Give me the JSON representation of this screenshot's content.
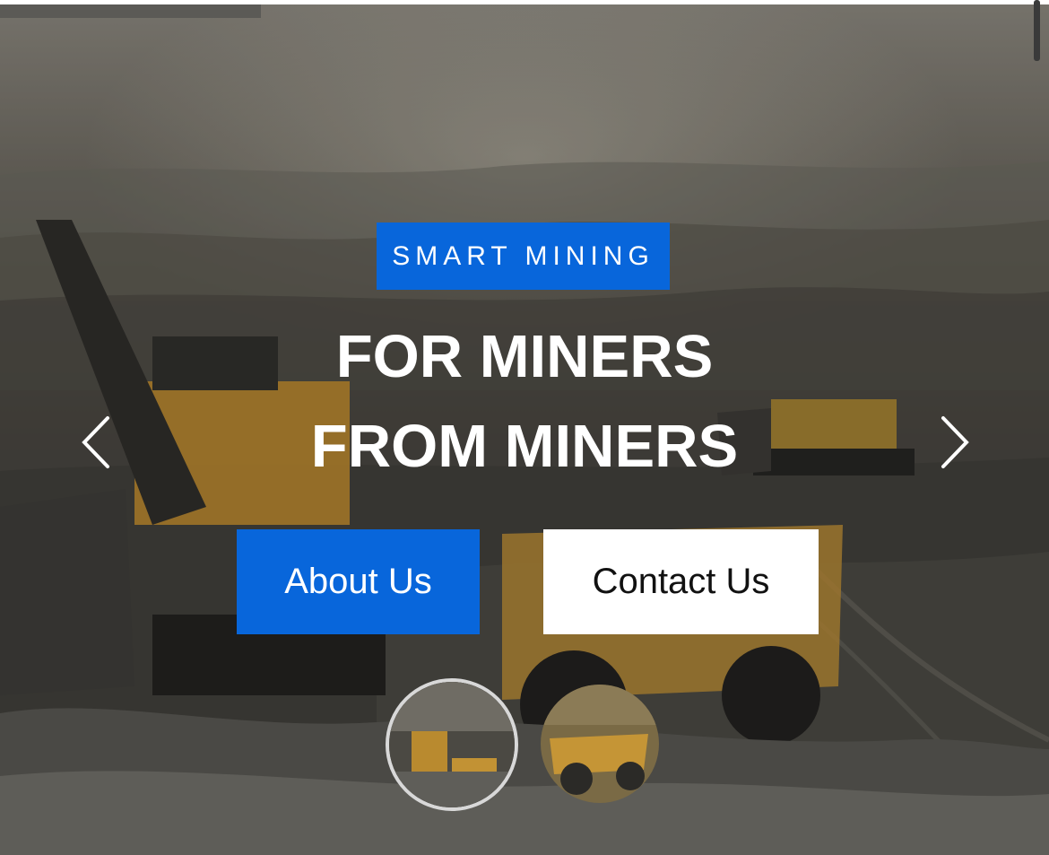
{
  "hero": {
    "tag": "SMART MINING",
    "headline_line1": "FOR MINERS",
    "headline_line2": "FROM MINERS",
    "prev_icon": "chevron-left-icon",
    "next_icon": "chevron-right-icon"
  },
  "buttons": {
    "about_label": "About Us",
    "contact_label": "Contact Us"
  },
  "colors": {
    "accent": "#0866db",
    "text_light": "#ffffff",
    "text_dark": "#111111"
  },
  "slides": {
    "thumbnails": [
      "slide-1-thumbnail",
      "slide-2-thumbnail"
    ],
    "active_index": 0
  }
}
